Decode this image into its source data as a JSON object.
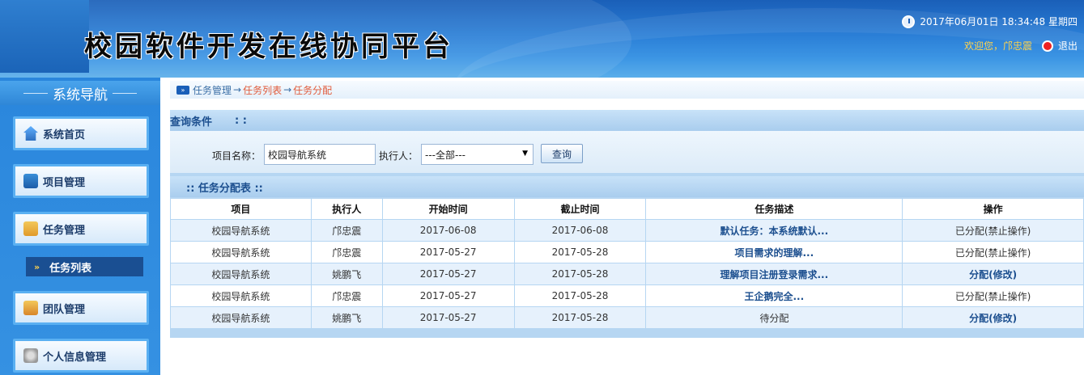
{
  "header": {
    "title": "校园软件开发在线协同平台",
    "clock": "2017年06月01日 18:34:48 星期四",
    "welcome": "欢迎您，邝忠震",
    "logout": "退出"
  },
  "sidebar": {
    "title": "系统导航",
    "items": [
      {
        "label": "系统首页",
        "icon": "home-icon"
      },
      {
        "label": "项目管理",
        "icon": "monitor-icon"
      },
      {
        "label": "任务管理",
        "icon": "task-icon"
      },
      {
        "label": "团队管理",
        "icon": "team-icon"
      },
      {
        "label": "个人信息管理",
        "icon": "user-gear-icon"
      }
    ],
    "sub_item": {
      "label": "任务列表",
      "marker": "»"
    }
  },
  "breadcrumb": {
    "icon_text": "»",
    "level1": "任务管理",
    "sep": "→",
    "level2": "任务列表",
    "level3": "任务分配"
  },
  "query": {
    "title": "查询条件",
    "title_suffix": ": :",
    "project_label": "项目名称：",
    "project_value": "校园导航系统",
    "executor_label": "执行人：",
    "executor_value": "---全部---",
    "search_button": "查询"
  },
  "table": {
    "title": ":: 任务分配表 ::",
    "columns": [
      "项目",
      "执行人",
      "开始时间",
      "截止时间",
      "任务描述",
      "操作"
    ],
    "rows": [
      {
        "project": "校园导航系统",
        "executor": "邝忠震",
        "start": "2017-06-08",
        "end": "2017-06-08",
        "desc": "默认任务：本系统默认...",
        "desc_link": true,
        "op": "已分配(禁止操作)",
        "op_link": false
      },
      {
        "project": "校园导航系统",
        "executor": "邝忠震",
        "start": "2017-05-27",
        "end": "2017-05-28",
        "desc": "项目需求的理解...",
        "desc_link": true,
        "op": "已分配(禁止操作)",
        "op_link": false
      },
      {
        "project": "校园导航系统",
        "executor": "姚鹏飞",
        "start": "2017-05-27",
        "end": "2017-05-28",
        "desc": "理解项目注册登录需求...",
        "desc_link": true,
        "op": "分配(修改)",
        "op_link": true
      },
      {
        "project": "校园导航系统",
        "executor": "邝忠震",
        "start": "2017-05-27",
        "end": "2017-05-28",
        "desc": "王企鹅完全...",
        "desc_link": true,
        "op": "已分配(禁止操作)",
        "op_link": false
      },
      {
        "project": "校园导航系统",
        "executor": "姚鹏飞",
        "start": "2017-05-27",
        "end": "2017-05-28",
        "desc": "待分配",
        "desc_link": false,
        "op": "分配(修改)",
        "op_link": true
      }
    ]
  }
}
